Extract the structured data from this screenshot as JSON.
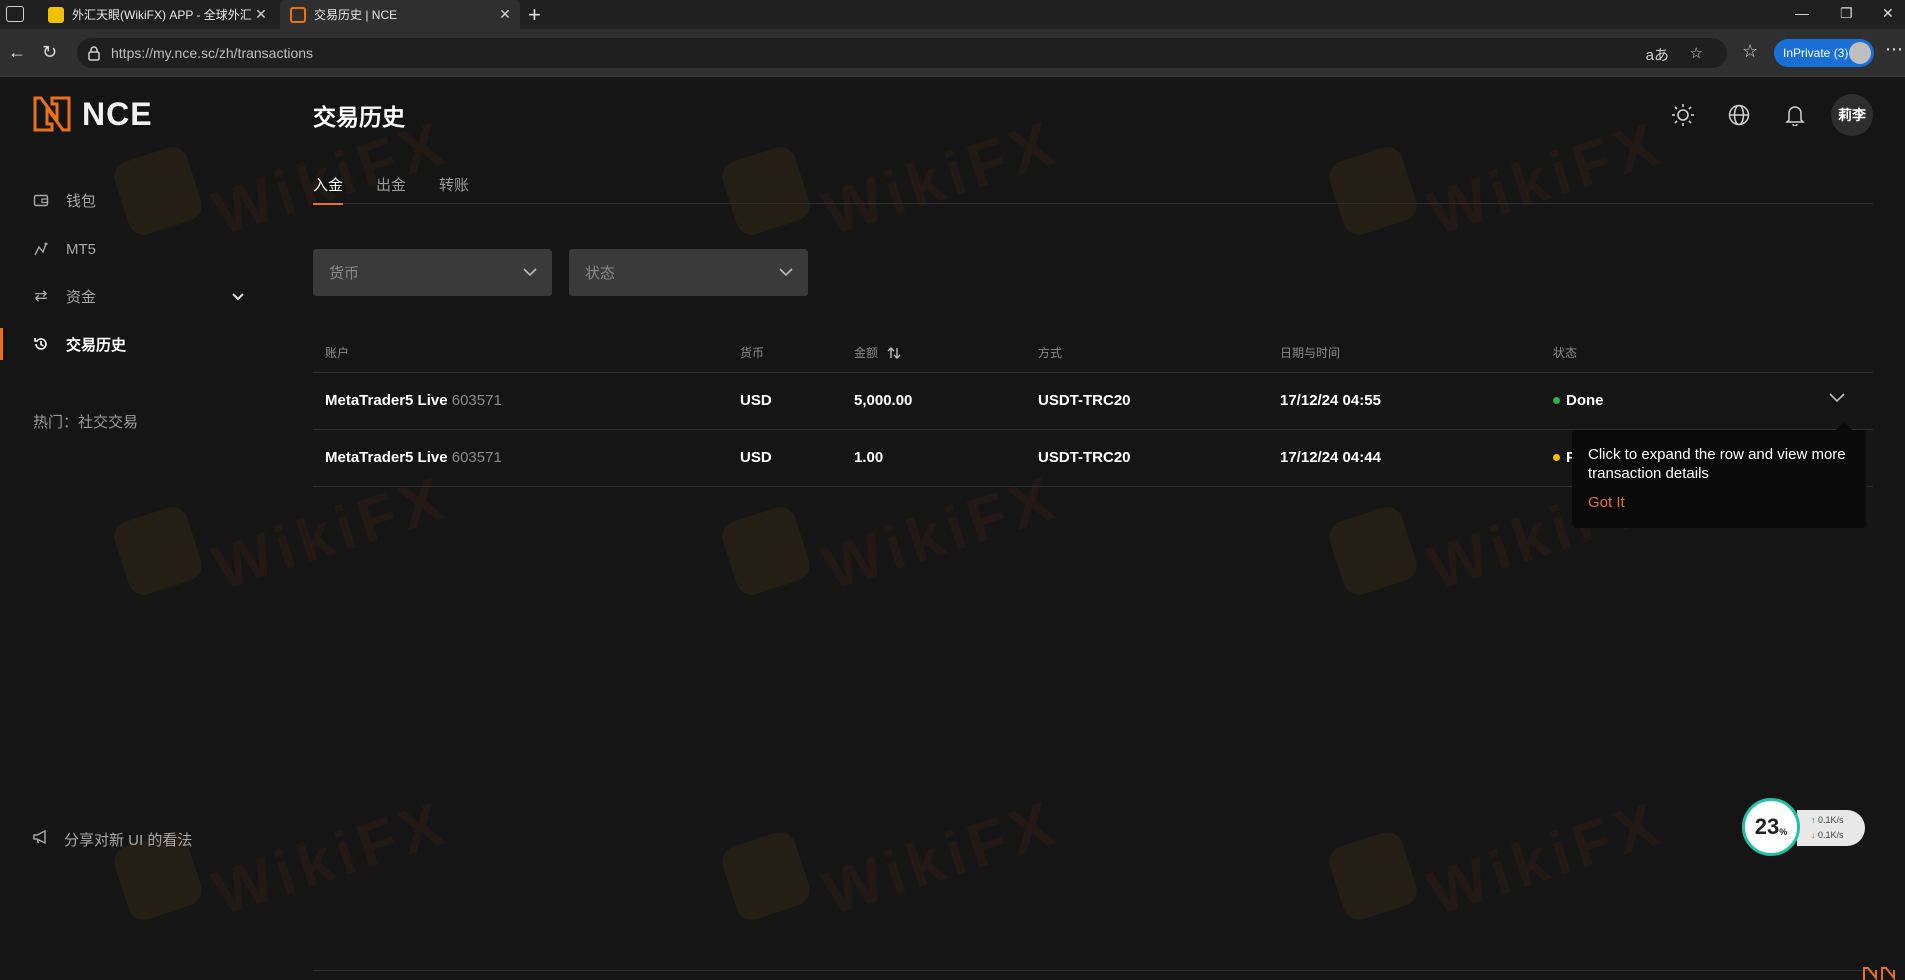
{
  "browser": {
    "tabs": [
      {
        "title": "外汇天眼(WikiFX) APP - 全球外汇"
      },
      {
        "title": "交易历史 | NCE"
      }
    ],
    "url": "https://my.nce.sc/zh/transactions",
    "inprivate_label": "InPrivate (3)"
  },
  "sidebar": {
    "brand": "NCE",
    "items": [
      {
        "label": "钱包",
        "icon": "wallet-icon"
      },
      {
        "label": "MT5",
        "icon": "mt5-icon"
      },
      {
        "label": "资金",
        "icon": "transfer-icon"
      },
      {
        "label": "交易历史",
        "icon": "history-icon"
      }
    ],
    "hot": "热门：社交交易",
    "share": "分享对新 UI 的看法"
  },
  "header": {
    "title": "交易历史",
    "user_initials": "莉李"
  },
  "tabs": [
    "入金",
    "出金",
    "转账"
  ],
  "filters": {
    "currency_placeholder": "货币",
    "status_placeholder": "状态"
  },
  "table": {
    "headers": [
      "账户",
      "货币",
      "金额",
      "方式",
      "日期与时间",
      "状态"
    ],
    "rows": [
      {
        "account": "MetaTrader5 Live",
        "account_no": "603571",
        "currency": "USD",
        "amount": "5,000.00",
        "method": "USDT-TRC20",
        "datetime": "17/12/24 04:55",
        "status": "Done",
        "status_color": "#2ab34a"
      },
      {
        "account": "MetaTrader5 Live",
        "account_no": "603571",
        "currency": "USD",
        "amount": "1.00",
        "method": "USDT-TRC20",
        "datetime": "17/12/24 04:44",
        "status": "P",
        "status_color": "#f5c000"
      }
    ]
  },
  "tooltip": {
    "text": "Click to expand the row and view more transaction details",
    "action": "Got It"
  },
  "speed_widget": {
    "percent": "23",
    "unit": "%",
    "up": "0.1K/s",
    "down": "0.1K/s"
  },
  "colors": {
    "accent": "#e8711a",
    "background": "#151515"
  }
}
